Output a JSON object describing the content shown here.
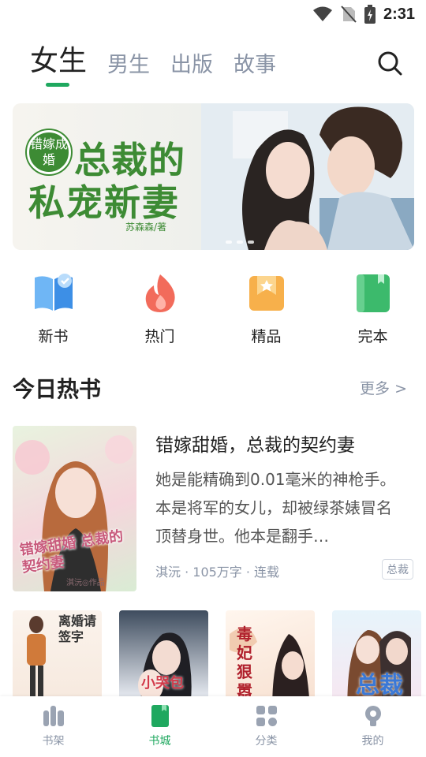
{
  "status": {
    "time": "2:31"
  },
  "tabs": [
    {
      "label": "女生",
      "active": true
    },
    {
      "label": "男生",
      "active": false
    },
    {
      "label": "出版",
      "active": false
    },
    {
      "label": "故事",
      "active": false
    }
  ],
  "banner": {
    "badge": "错嫁成婚",
    "title_line1": "总裁的",
    "title_line2": "私宠新妻",
    "author": "苏森森/著"
  },
  "quick": [
    {
      "label": "新书",
      "icon": "new-book-icon",
      "color": "#4a9fee"
    },
    {
      "label": "热门",
      "icon": "flame-icon",
      "color": "#f26b5b"
    },
    {
      "label": "精品",
      "icon": "star-icon",
      "color": "#f5a742"
    },
    {
      "label": "完本",
      "icon": "finished-book-icon",
      "color": "#3cba6c"
    }
  ],
  "section": {
    "title": "今日热书",
    "more": "更多 >"
  },
  "feature_book": {
    "title": "错嫁甜婚，总裁的契约妻",
    "description": "她是能精确到0.01毫米的神枪手。本是将军的女儿，却被绿茶婊冒名顶替身世。他本是翻手…",
    "meta": "淇沅 · 105万字 · 连载",
    "tag": "总裁",
    "cover_text": "错嫁甜婚 总裁的契约妻",
    "cover_author": "淇沅◎作品"
  },
  "small_covers": [
    {
      "title": "离婚请签字"
    },
    {
      "title": "小哭包"
    },
    {
      "title": "毒妃狠嚣张"
    },
    {
      "title": "总裁"
    }
  ],
  "nav": [
    {
      "label": "书架",
      "icon": "bookshelf-icon",
      "active": false
    },
    {
      "label": "书城",
      "icon": "bookstore-icon",
      "active": true
    },
    {
      "label": "分类",
      "icon": "category-icon",
      "active": false
    },
    {
      "label": "我的",
      "icon": "profile-icon",
      "active": false
    }
  ],
  "colors": {
    "accent": "#1fa85f",
    "muted": "#8a94a6",
    "banner_green": "#3d8b34"
  }
}
